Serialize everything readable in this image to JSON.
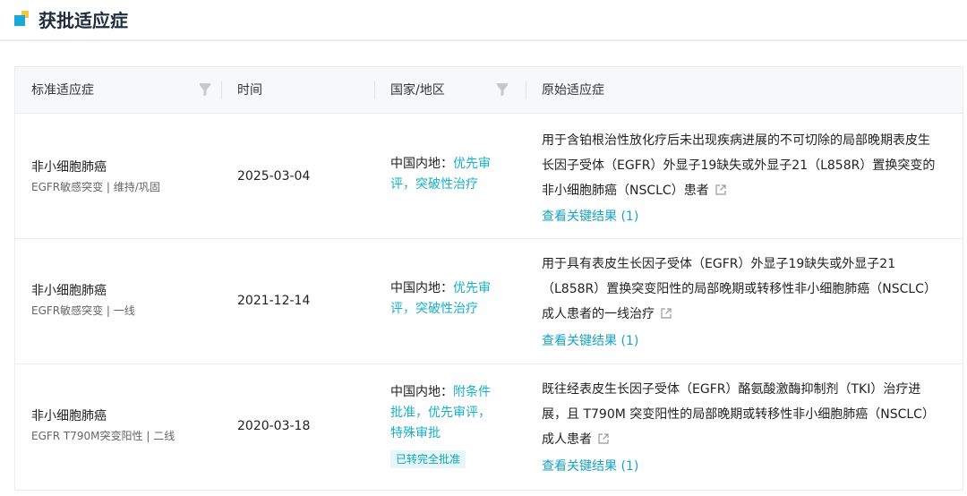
{
  "section": {
    "title": "获批适应症"
  },
  "table": {
    "headers": {
      "indication": "标准适应症",
      "time": "时间",
      "region": "国家/地区",
      "original": "原始适应症"
    },
    "rows": [
      {
        "name": "非小细胞肺癌",
        "sub": "EGFR敏感突变 | 维持/巩固",
        "date": "2025-03-04",
        "region_prefix": "中国内地：",
        "region_line1": "优先审",
        "region_line2": "评，突破性治疗",
        "original_lines": [
          "用于含铂根治性放化疗后未出现疾病进展的不可切除的局部晚期表皮生",
          "长因子受体（EGFR）外显子19缺失或外显子21（L858R）置换突变的",
          "非小细胞肺癌（NSCLC）患者"
        ],
        "key_results": "查看关键结果 (1)"
      },
      {
        "name": "非小细胞肺癌",
        "sub": "EGFR敏感突变 | 一线",
        "date": "2021-12-14",
        "region_prefix": "中国内地：",
        "region_line1": "优先审",
        "region_line2": "评，突破性治疗",
        "original_lines": [
          "用于具有表皮生长因子受体（EGFR）外显子19缺失或外显子21",
          "（L858R）置换突变阳性的局部晚期或转移性非小细胞肺癌（NSCLC）",
          "成人患者的一线治疗"
        ],
        "key_results": "查看关键结果 (1)"
      },
      {
        "name": "非小细胞肺癌",
        "sub": "EGFR T790M突变阳性 | 二线",
        "date": "2020-03-18",
        "region_prefix": "中国内地：",
        "region_line1": "附条件",
        "region_line2": "批准，优先审评，",
        "region_line3": "特殊审批",
        "badge": "已转完全批准",
        "original_lines": [
          "既往经表皮生长因子受体（EGFR）酪氨酸激酶抑制剂（TKI）治疗进",
          "展，且 T790M 突变阳性的局部晚期或转移性非小细胞肺癌（NSCLC）",
          "成人患者"
        ],
        "key_results": "查看关键结果 (1)"
      }
    ]
  },
  "icons": {
    "section": "section-square-icon",
    "filter": "filter-icon",
    "external": "external-link-icon"
  },
  "colors": {
    "accent": "#16b0c8",
    "link": "#16a3c4",
    "badge_bg": "#e6f7f9"
  }
}
